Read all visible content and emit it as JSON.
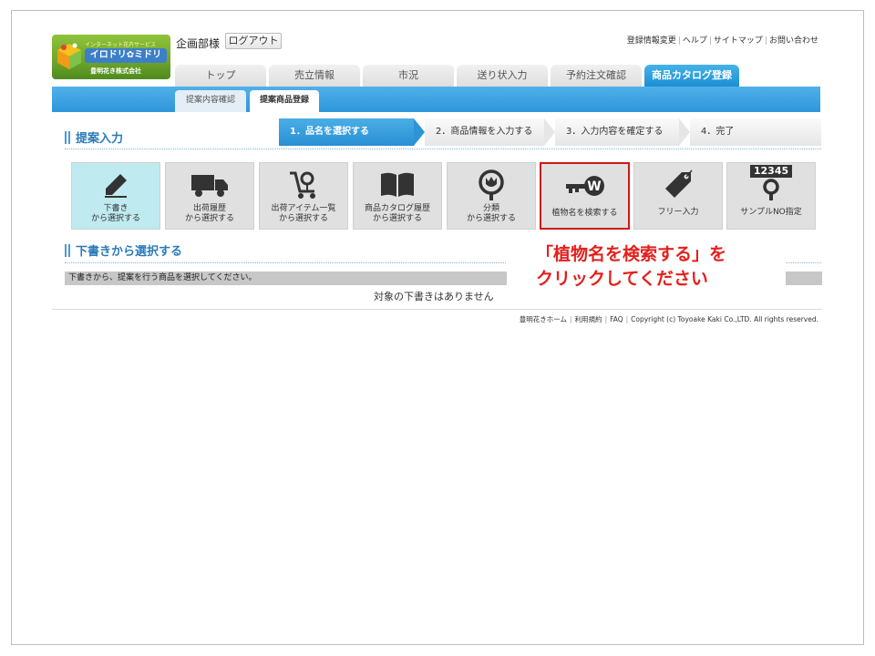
{
  "logo": {
    "tagline": "インターネット花卉サービス",
    "brand": "イロドリ✿ミドリ",
    "company": "豊明花き株式会社"
  },
  "header": {
    "user_name": "企画部様",
    "logout_label": "ログアウト",
    "links": [
      "登録情報変更",
      "ヘルプ",
      "サイトマップ",
      "お問い合わせ"
    ]
  },
  "main_tabs": [
    {
      "label": "トップ",
      "active": false
    },
    {
      "label": "売立情報",
      "active": false
    },
    {
      "label": "市況",
      "active": false
    },
    {
      "label": "送り状入力",
      "active": false
    },
    {
      "label": "予約注文確認",
      "active": false
    },
    {
      "label": "商品カタログ登録",
      "active": true
    }
  ],
  "sub_tabs": [
    {
      "label": "提案内容確認",
      "active": false
    },
    {
      "label": "提案商品登録",
      "active": true
    }
  ],
  "section1_title": "提案入力",
  "steps": [
    {
      "label": "1．品名を選択する",
      "active": true
    },
    {
      "label": "2．商品情報を入力する",
      "active": false
    },
    {
      "label": "3．入力内容を確定する",
      "active": false
    },
    {
      "label": "4．完了",
      "active": false
    }
  ],
  "tiles": [
    {
      "icon": "pencil-icon",
      "line1": "下書き",
      "line2": "から選択する",
      "active": true,
      "highlight": false
    },
    {
      "icon": "truck-icon",
      "line1": "出荷履歴",
      "line2": "から選択する",
      "active": false,
      "highlight": false
    },
    {
      "icon": "cart-flower-icon",
      "line1": "出荷アイテム一覧",
      "line2": "から選択する",
      "active": false,
      "highlight": false
    },
    {
      "icon": "book-icon",
      "line1": "商品カタログ履歴",
      "line2": "から選択する",
      "active": false,
      "highlight": false
    },
    {
      "icon": "tulip-search-icon",
      "line1": "分類",
      "line2": "から選択する",
      "active": false,
      "highlight": false
    },
    {
      "icon": "key-w-icon",
      "line1": "植物名を検索する",
      "line2": "",
      "active": false,
      "highlight": true
    },
    {
      "icon": "price-tag-icon",
      "line1": "フリー入力",
      "line2": "",
      "active": false,
      "highlight": false
    },
    {
      "icon": "number-search-icon",
      "line1": "サンプルNO指定",
      "line2": "",
      "active": false,
      "highlight": false
    }
  ],
  "sample_number": "12345",
  "section2_title": "下書きから選択する",
  "draft_instruction": "下書きから、提案を行う商品を選択してください。",
  "empty_message": "対象の下書きはありません",
  "callout": {
    "line1": "「植物名を検索する」を",
    "line2": "クリックしてください"
  },
  "footer": {
    "links": [
      "豊明花きホーム",
      "利用規約",
      "FAQ"
    ],
    "copyright": "Copyright (c) Toyoake Kaki Co.,LTD. All rights reserved."
  },
  "colors": {
    "accent_blue": "#2f96db",
    "callout_red": "#e2201c",
    "active_tile": "#bfeaf0"
  }
}
